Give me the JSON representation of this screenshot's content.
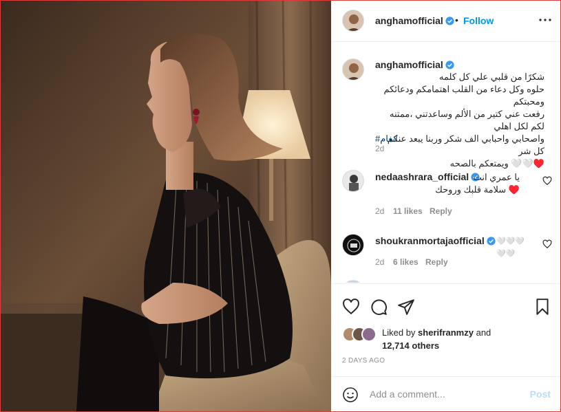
{
  "post": {
    "photo_icon": "portrait-photo"
  },
  "header": {
    "username": "anghamofficial",
    "separator": "•",
    "follow_label": "Follow",
    "more_icon": "more-icon"
  },
  "caption": {
    "username": "anghamofficial",
    "text": "شكرًا من قلبي علي كل كلمه\nحلوه وكل دعاء من القلب اهتمامكم ودعائكم ومحبتكم\nرفعت عني كتير من الألم وساعدتني ،ممتنه لكم لكل اهلي\nواصحابي واحبابي الف شكر وربنا يبعد عنكم كل شر\n♥️🤍🤍 ويمتعكم بالصحه",
    "hashtag": "#انغام",
    "time": "2d"
  },
  "comments": [
    {
      "username": "nedaashrara_official",
      "text": "يا عمري انت\n♥️ سلامة قلبك وروحك",
      "time": "2d",
      "likes": "11 likes",
      "reply": "Reply"
    },
    {
      "username": "shoukranmortajaofficial",
      "text": "🤍🤍🤍🤍🤍",
      "time": "2d",
      "likes": "6 likes",
      "reply": "Reply"
    }
  ],
  "actions": {
    "like_icon": "heart-icon",
    "comment_icon": "comment-icon",
    "share_icon": "share-icon",
    "save_icon": "bookmark-icon"
  },
  "likes": {
    "prefix": "Liked by",
    "user": "sherifranmzy",
    "and": "and",
    "count": "12,714 others"
  },
  "date": "2 DAYS AGO",
  "add_comment": {
    "placeholder": "Add a comment...",
    "post_label": "Post",
    "emoji_icon": "smiley-icon"
  },
  "colors": {
    "accent": "#0095f6",
    "text": "#262626",
    "muted": "#8e8e8e",
    "verified": "#3897f0",
    "border": "#efefef"
  }
}
